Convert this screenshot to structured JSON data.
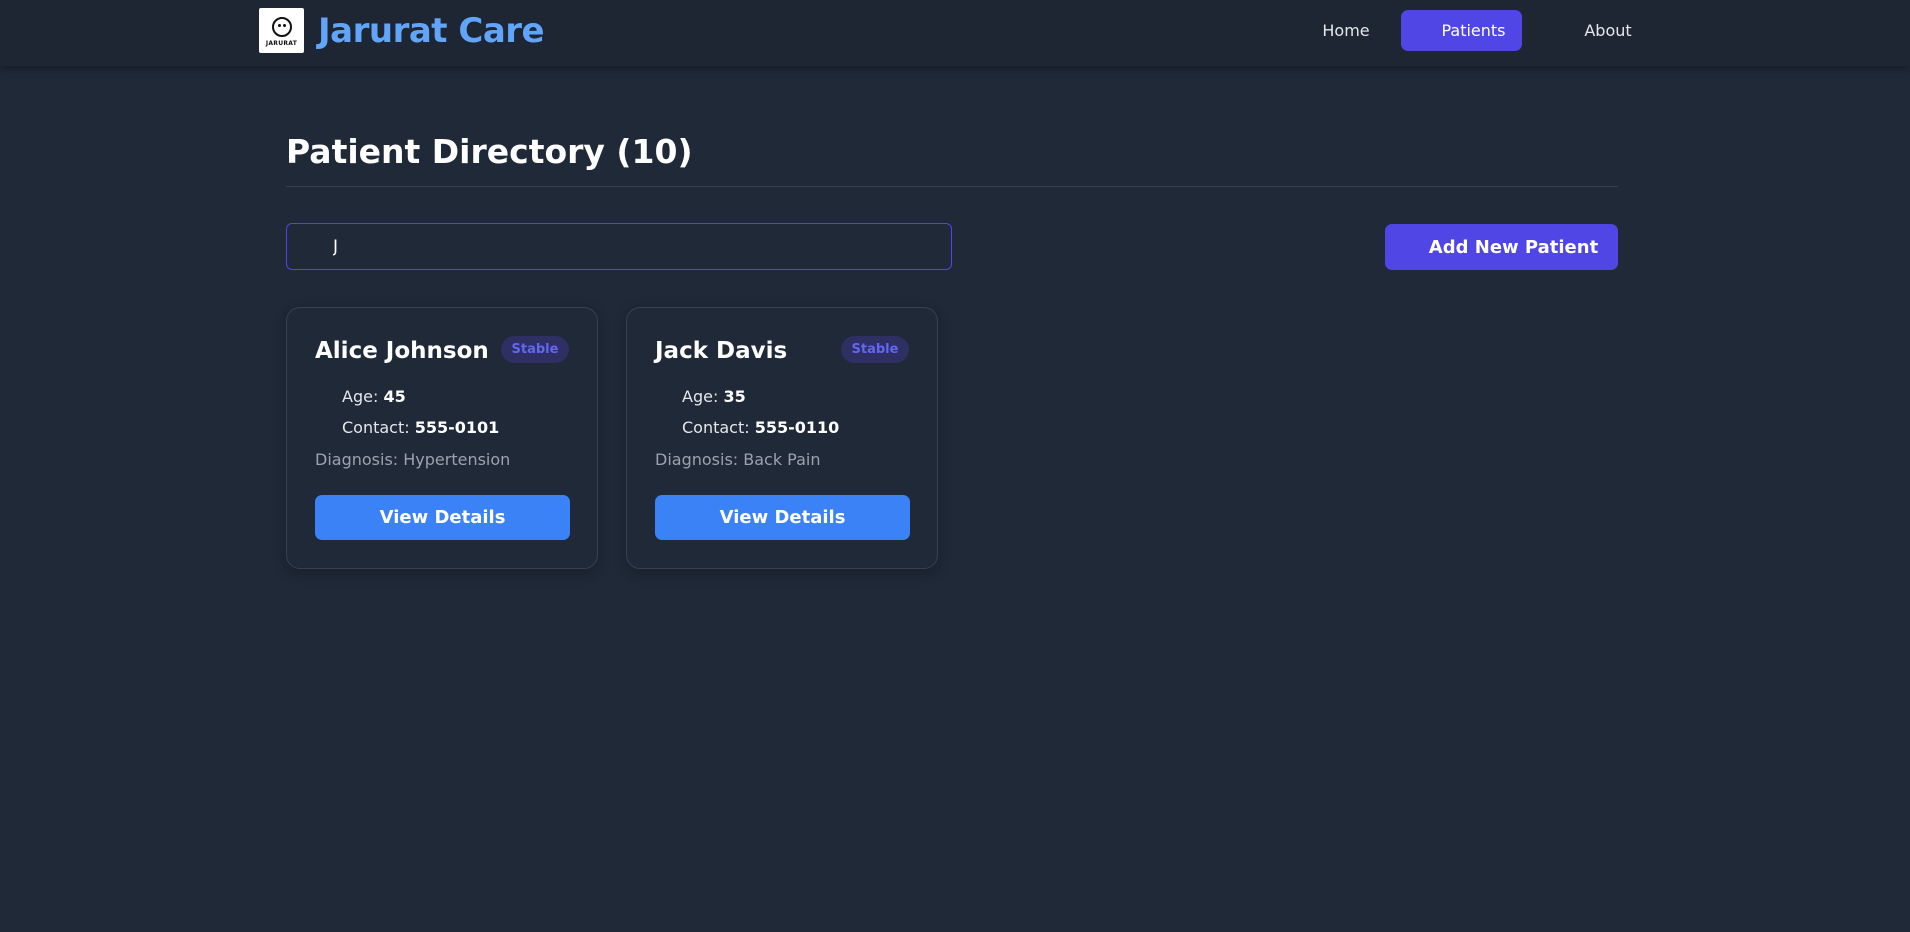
{
  "nav": {
    "brand": "Jarurat Care",
    "logo_text": "JARURAT",
    "links": [
      {
        "label": "Home",
        "active": false
      },
      {
        "label": "Patients",
        "active": true
      },
      {
        "label": "About",
        "active": false
      }
    ]
  },
  "page": {
    "title": "Patient Directory (10)"
  },
  "search": {
    "value": "J",
    "placeholder": ""
  },
  "actions": {
    "add_label": "Add New Patient"
  },
  "patients": [
    {
      "name": "Alice Johnson",
      "status": "Stable",
      "age_label": "Age:",
      "age": "45",
      "contact_label": "Contact:",
      "contact": "555-0101",
      "diagnosis": "Diagnosis: Hypertension",
      "button": "View Details"
    },
    {
      "name": "Jack Davis",
      "status": "Stable",
      "age_label": "Age:",
      "age": "35",
      "contact_label": "Contact:",
      "contact": "555-0110",
      "diagnosis": "Diagnosis: Back Pain",
      "button": "View Details"
    }
  ],
  "colors": {
    "background": "#1f2937",
    "navbar": "#1e2533",
    "brand": "#60a5fa",
    "accent": "#4f46e5",
    "primary_button": "#3b82f6",
    "badge_text": "#6366f1"
  }
}
